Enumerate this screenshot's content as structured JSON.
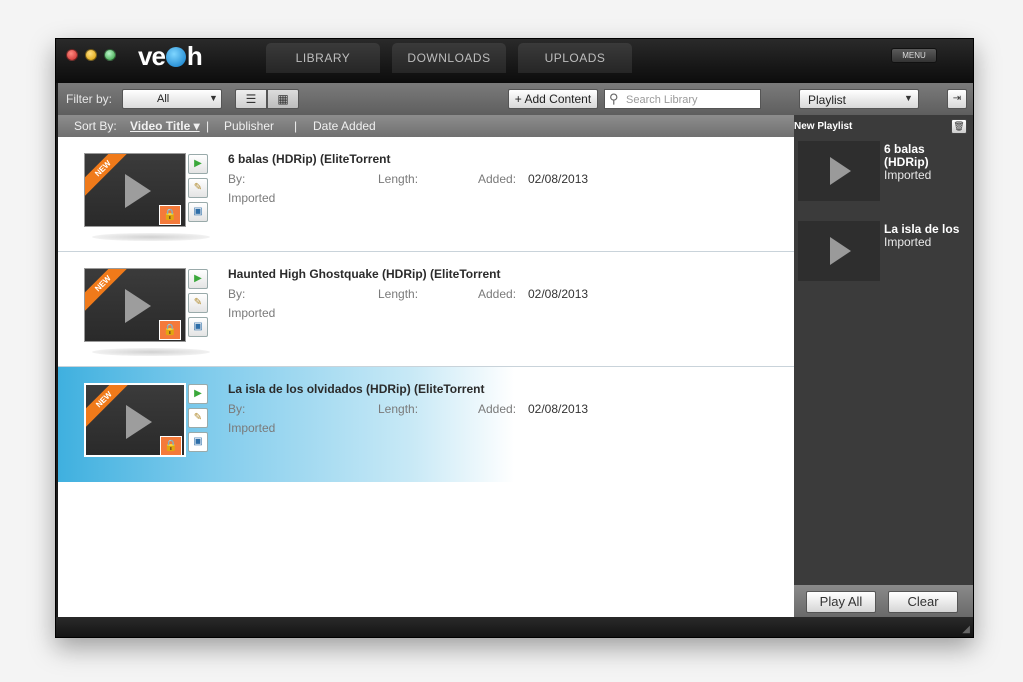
{
  "app": {
    "logo": {
      "prefix": "ve",
      "suffix": "h"
    }
  },
  "tabs": [
    {
      "label": "LIBRARY"
    },
    {
      "label": "DOWNLOADS"
    },
    {
      "label": "UPLOADS"
    }
  ],
  "menu_label": "MENU",
  "toolbar": {
    "filter_label": "Filter by:",
    "filter_value": "All",
    "add_content_label": "+ Add Content",
    "search_placeholder": "Search Library"
  },
  "sort": {
    "label": "Sort By:",
    "options": [
      {
        "label": "Video Title ▾",
        "active": true
      },
      {
        "label": "Publisher"
      },
      {
        "label": "Date Added"
      }
    ],
    "separator": "|"
  },
  "videos": [
    {
      "title": "6 balas (HDRip) (EliteTorrent",
      "by_label": "By:",
      "length_label": "Length:",
      "added_label": "Added:",
      "added_date": "02/08/2013",
      "status": "Imported",
      "badge": "NEW"
    },
    {
      "title": "Haunted High Ghostquake (HDRip) (EliteTorrent",
      "by_label": "By:",
      "length_label": "Length:",
      "added_label": "Added:",
      "added_date": "02/08/2013",
      "status": "Imported",
      "badge": "NEW"
    },
    {
      "title": "La isla de los olvidados (HDRip) (EliteTorrent",
      "by_label": "By:",
      "length_label": "Length:",
      "added_label": "Added:",
      "added_date": "02/08/2013",
      "status": "Imported",
      "badge": "NEW",
      "selected": true
    }
  ],
  "playlist": {
    "select_value": "Playlist",
    "new_playlist_label": "New Playlist",
    "items": [
      {
        "title": "6 balas (HDRip)",
        "status": "Imported"
      },
      {
        "title": "La isla de los",
        "status": "Imported"
      }
    ],
    "play_all_label": "Play All",
    "clear_label": "Clear"
  },
  "colors": {
    "accent_blue": "#3fb0df",
    "badge_orange": "#f07a1a",
    "lock_orange": "#f47a3a"
  },
  "icons": {
    "list_view": "list-icon",
    "grid_view": "grid-icon",
    "search": "search-icon",
    "lock": "lock-icon",
    "play": "play-icon",
    "edit": "edit-icon",
    "info": "info-icon",
    "trash": "trash-icon",
    "export": "export-icon"
  }
}
